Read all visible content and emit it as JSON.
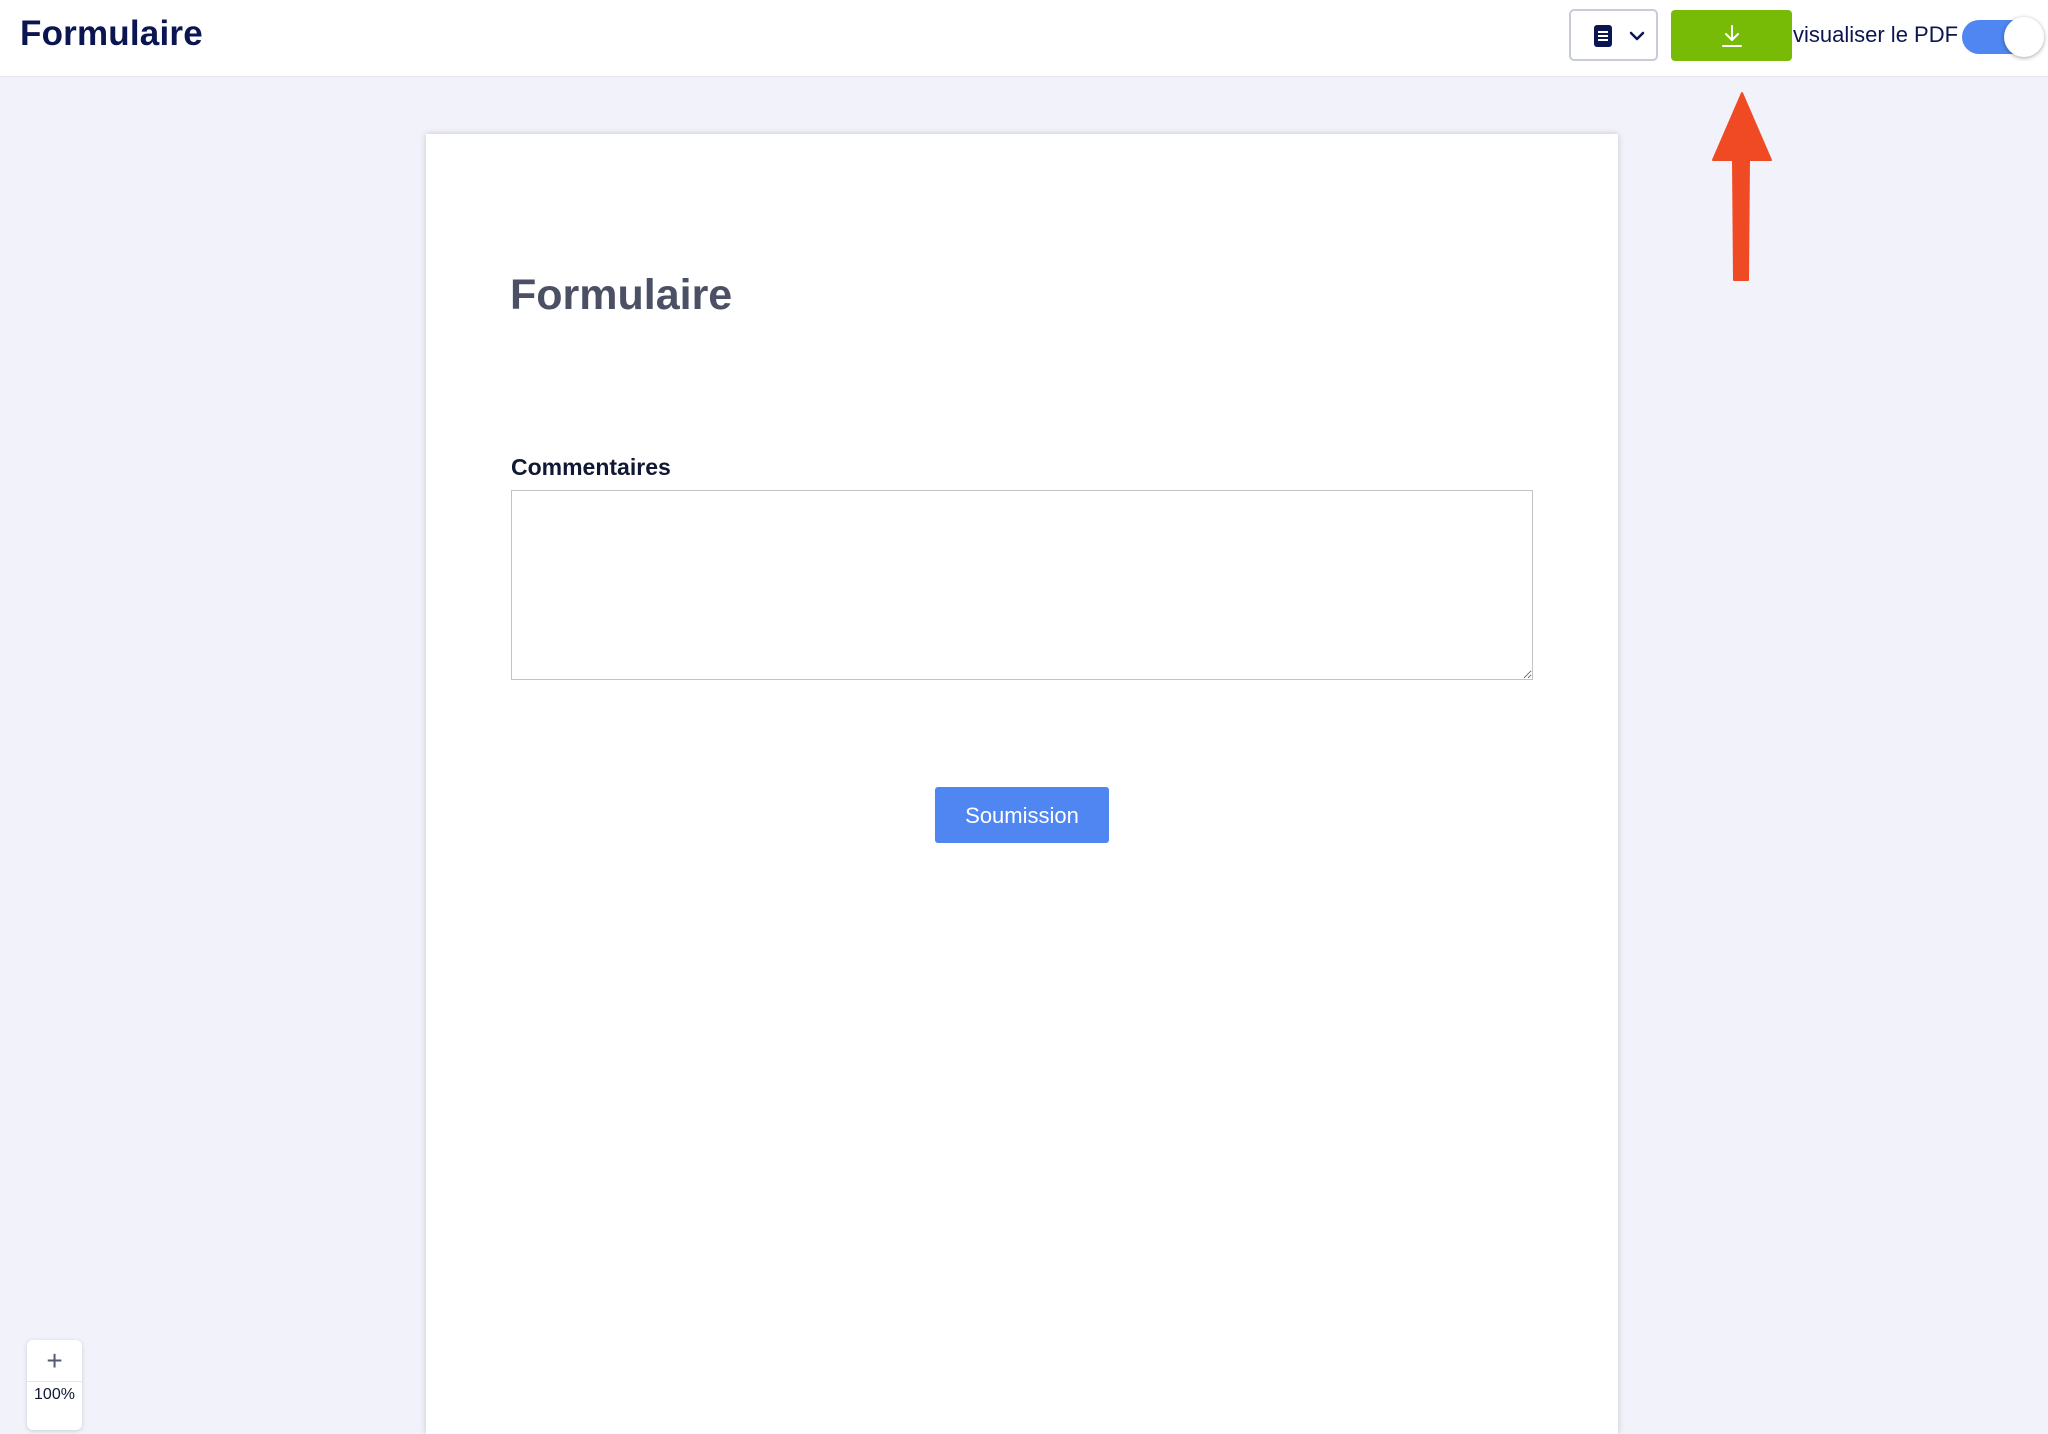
{
  "header": {
    "title": "Formulaire",
    "download_icon": "download-icon",
    "document_icon": "document-icon",
    "pdf_toggle_label": "visualiser le PDF",
    "pdf_toggle_on": true,
    "download_color": "#78bb07",
    "toggle_color": "#4f86f2"
  },
  "form": {
    "title": "Formulaire",
    "comments_label": "Commentaires",
    "comments_value": "",
    "submit_label": "Soumission",
    "submit_color": "#4f86f2"
  },
  "zoom": {
    "plus_label": "+",
    "level": "100%"
  },
  "annotation": {
    "arrow_color": "#f04a24",
    "arrow_icon": "red-arrow-up"
  }
}
